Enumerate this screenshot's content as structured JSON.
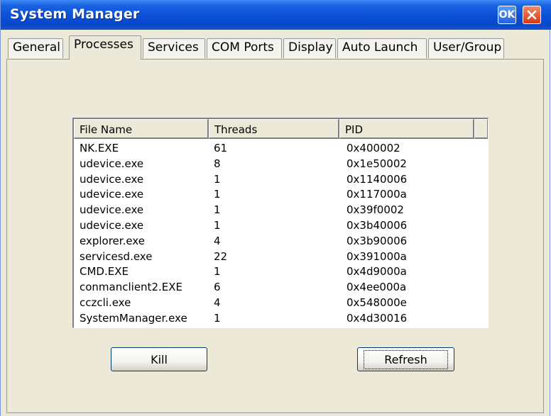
{
  "window": {
    "title": "System Manager",
    "ok_label": "OK"
  },
  "tabs": [
    {
      "label": "General"
    },
    {
      "label": "Processes"
    },
    {
      "label": "Services"
    },
    {
      "label": "COM Ports"
    },
    {
      "label": "Display"
    },
    {
      "label": "Auto Launch"
    },
    {
      "label": "User/Group"
    }
  ],
  "active_tab": "Processes",
  "process_list": {
    "columns": [
      "File Name",
      "Threads",
      "PID"
    ],
    "rows": [
      [
        "NK.EXE",
        "61",
        "0x400002"
      ],
      [
        "udevice.exe",
        "8",
        "0x1e50002"
      ],
      [
        "udevice.exe",
        "1",
        "0x1140006"
      ],
      [
        "udevice.exe",
        "1",
        "0x117000a"
      ],
      [
        "udevice.exe",
        "1",
        "0x39f0002"
      ],
      [
        "udevice.exe",
        "1",
        "0x3b40006"
      ],
      [
        "explorer.exe",
        "4",
        "0x3b90006"
      ],
      [
        "servicesd.exe",
        "22",
        "0x391000a"
      ],
      [
        "CMD.EXE",
        "1",
        "0x4d9000a"
      ],
      [
        "conmanclient2.EXE",
        "6",
        "0x4ee000a"
      ],
      [
        "cczcli.exe",
        "4",
        "0x548000e"
      ],
      [
        "SystemManager.exe",
        "1",
        "0x4d30016"
      ]
    ]
  },
  "buttons": {
    "kill": "Kill",
    "refresh": "Refresh"
  },
  "colors": {
    "titlebar": "#0a4fd6",
    "close": "#d43a12",
    "panel": "#ece9d8"
  }
}
